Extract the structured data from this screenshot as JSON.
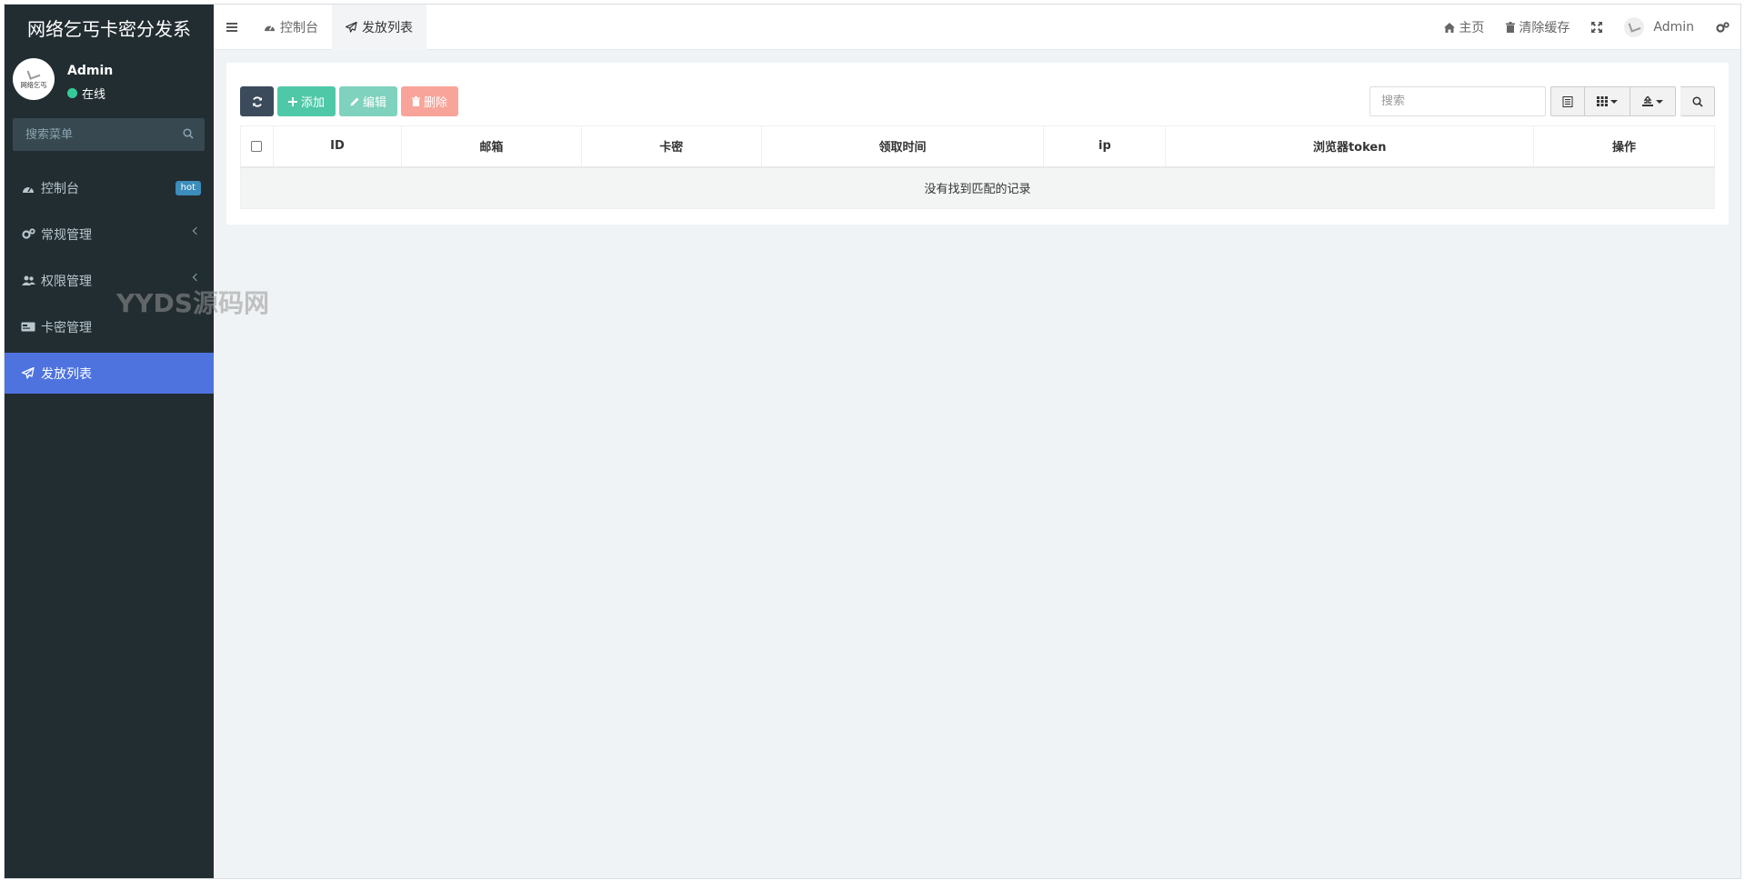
{
  "app": {
    "title": "网络乞丐卡密分发系"
  },
  "user": {
    "name": "Admin",
    "status": "在线",
    "avatar_text": "网络乞丐"
  },
  "sidebar": {
    "search_placeholder": "搜索菜单",
    "items": [
      {
        "label": "控制台",
        "icon": "dashboard-icon",
        "badge": "hot"
      },
      {
        "label": "常规管理",
        "icon": "cogs-icon"
      },
      {
        "label": "权限管理",
        "icon": "users-icon"
      },
      {
        "label": "卡密管理",
        "icon": "card-icon"
      },
      {
        "label": "发放列表",
        "icon": "paper-plane-icon",
        "active": true
      }
    ]
  },
  "header": {
    "tabs": [
      {
        "label": "控制台",
        "icon": "dashboard-icon"
      },
      {
        "label": "发放列表",
        "icon": "paper-plane-icon",
        "active": true
      }
    ],
    "home": "主页",
    "clear_cache": "清除缓存",
    "admin": "Admin"
  },
  "watermark": "YYDS源码网",
  "toolbar": {
    "add": "添加",
    "edit": "编辑",
    "delete": "删除",
    "search_placeholder": "搜索"
  },
  "table": {
    "columns": [
      "ID",
      "邮箱",
      "卡密",
      "领取时间",
      "ip",
      "浏览器token",
      "操作"
    ],
    "empty_text": "没有找到匹配的记录"
  },
  "colors": {
    "sidebar_bg": "#222d32",
    "active_menu": "#4e73df",
    "add_btn": "#4fc8a8",
    "edit_btn": "#7fd2bd",
    "delete_btn": "#f8a49a",
    "refresh_btn": "#3c4b5c"
  }
}
